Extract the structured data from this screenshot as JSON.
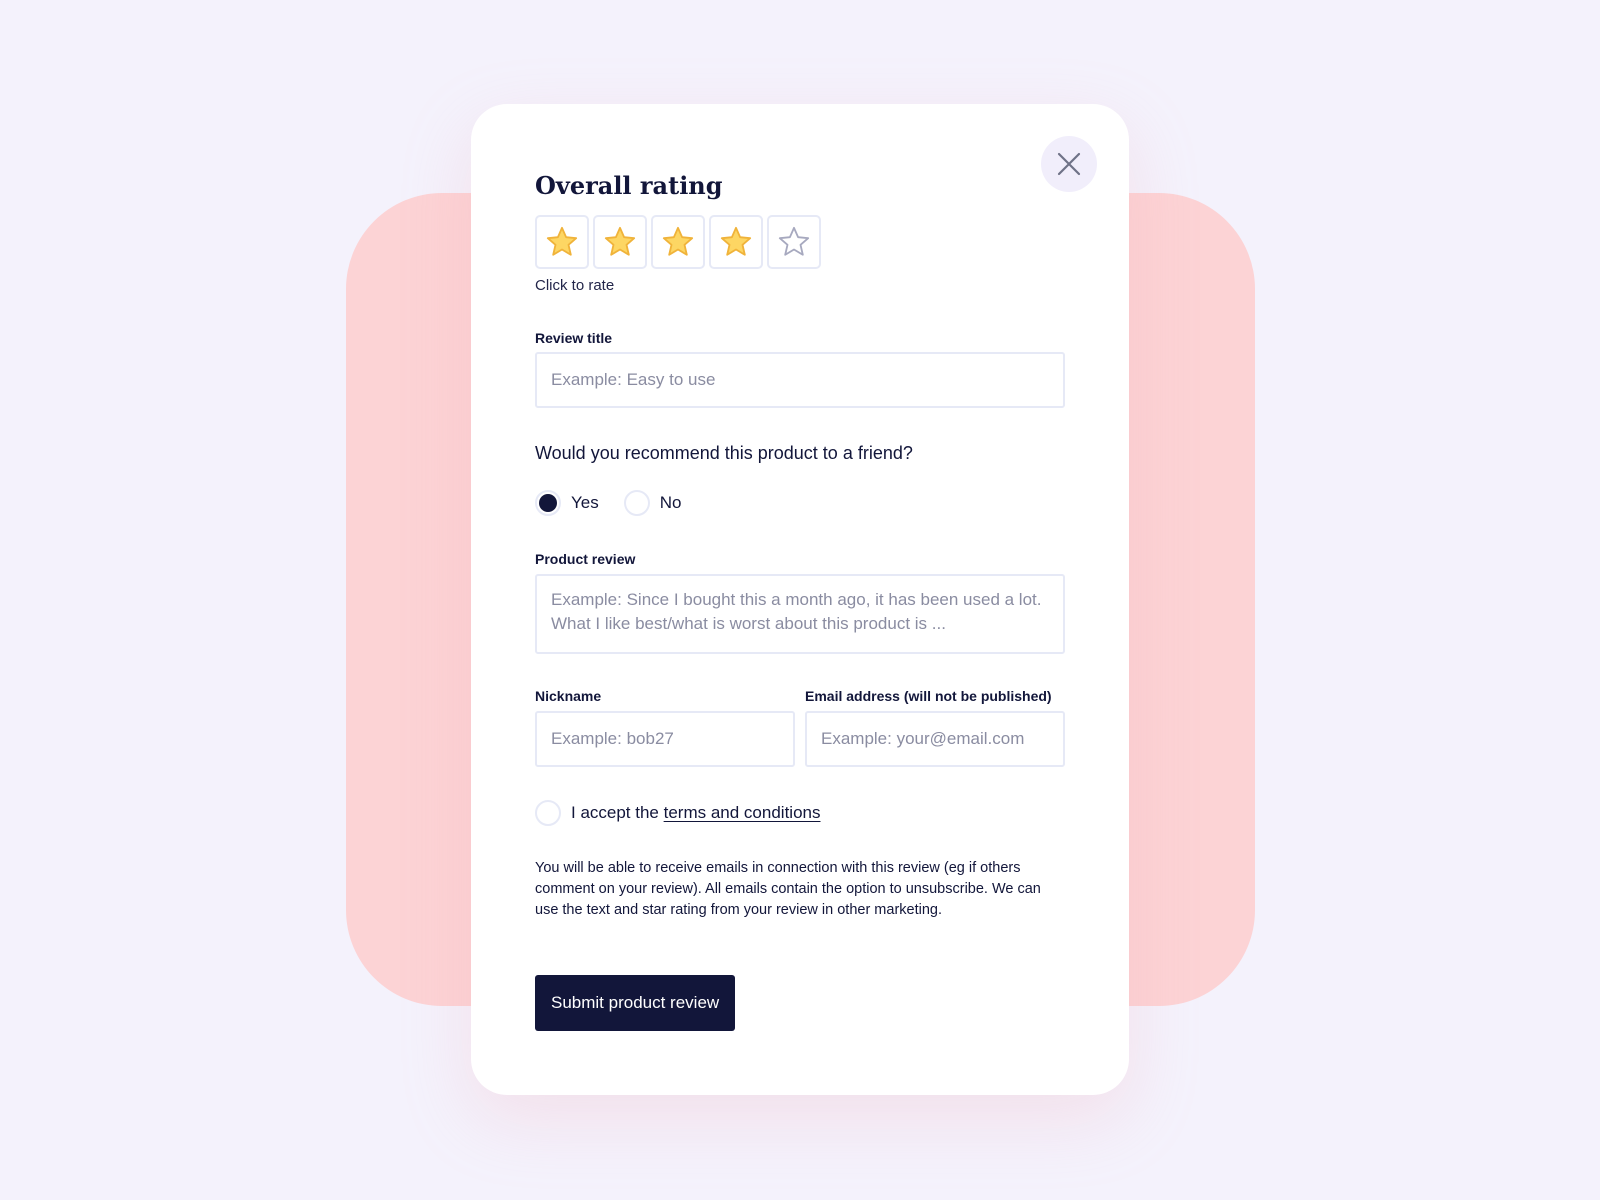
{
  "rating": {
    "heading": "Overall rating",
    "value": 4,
    "max": 5,
    "hint": "Click to rate",
    "filled_color": "#fdd663",
    "empty_color": "#a7a9bf"
  },
  "review_title": {
    "label": "Review title",
    "placeholder": "Example: Easy to use"
  },
  "recommend": {
    "question": "Would you recommend this product to a friend?",
    "options": [
      "Yes",
      "No"
    ],
    "selected": "Yes"
  },
  "product_review": {
    "label": "Product review",
    "placeholder": "Example: Since I bought this a month ago, it has been used a lot. What I like best/what is worst about this product is ..."
  },
  "nickname": {
    "label": "Nickname",
    "placeholder": "Example: bob27"
  },
  "email": {
    "label": "Email address (will not be published)",
    "placeholder": "Example: your@email.com"
  },
  "terms": {
    "prefix": "I accept the ",
    "link_text": "terms and conditions",
    "checked": false
  },
  "disclaimer": "You will be able to receive emails in connection with this review (eg if others comment on your review). All emails contain the option to unsubscribe. We can use the text and star rating from your review in other marketing.",
  "submit_label": "Submit product review",
  "colors": {
    "primary": "#12163a",
    "backdrop": "#fcd3d5",
    "page_background": "#f4f2fc"
  }
}
